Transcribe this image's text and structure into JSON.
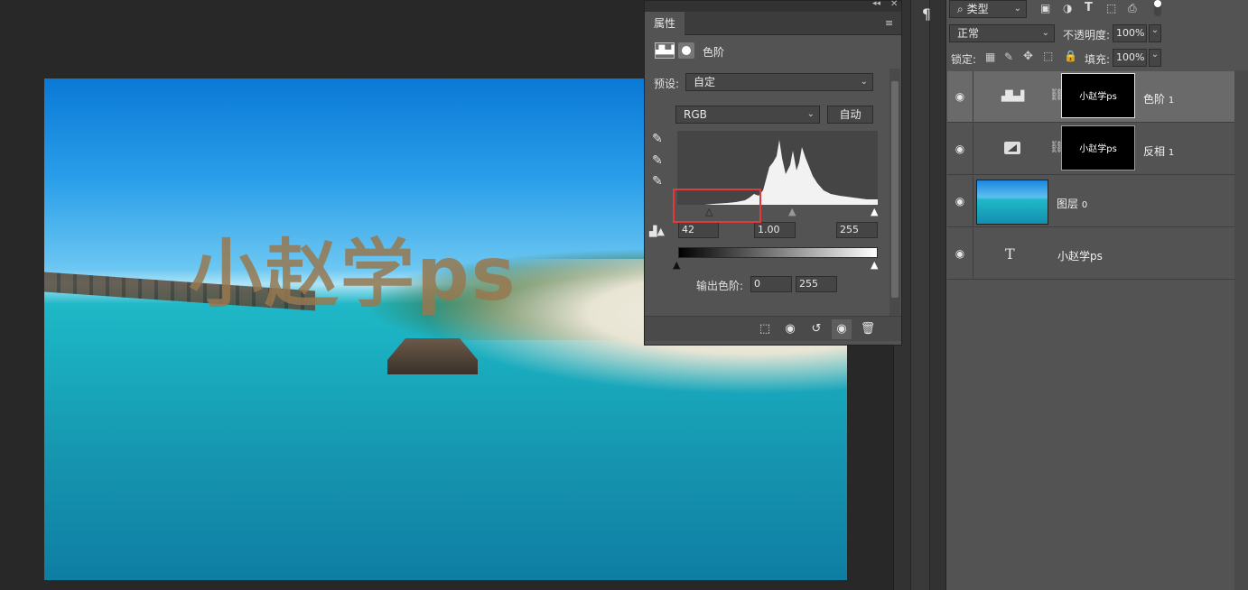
{
  "canvas": {
    "watermark_text": "小赵学ps"
  },
  "properties": {
    "tab_label": "属性",
    "title": "色阶",
    "preset_label": "预设:",
    "preset_value": "自定",
    "channel_value": "RGB",
    "auto_button": "自动",
    "input_black": "42",
    "input_gamma": "1.00",
    "input_white": "255",
    "output_label": "输出色阶:",
    "output_black": "0",
    "output_white": "255"
  },
  "layers_toolbar": {
    "filter_label": "类型",
    "blend_mode": "正常",
    "opacity_label": "不透明度:",
    "opacity_value": "100%",
    "lock_label": "锁定:",
    "fill_label": "填充:",
    "fill_value": "100%"
  },
  "layers": [
    {
      "name": "色阶",
      "index": "1",
      "mask_text": "小赵学ps",
      "selected": true
    },
    {
      "name": "反相",
      "index": "1",
      "mask_text": "小赵学ps",
      "selected": false
    },
    {
      "name": "图层",
      "index": "0",
      "selected": false
    },
    {
      "name": "小赵学ps",
      "selected": false
    }
  ],
  "colors": {
    "highlight_box": "#e23a3a",
    "panel_bg": "#535353",
    "selected_row": "#6a6a6a"
  }
}
